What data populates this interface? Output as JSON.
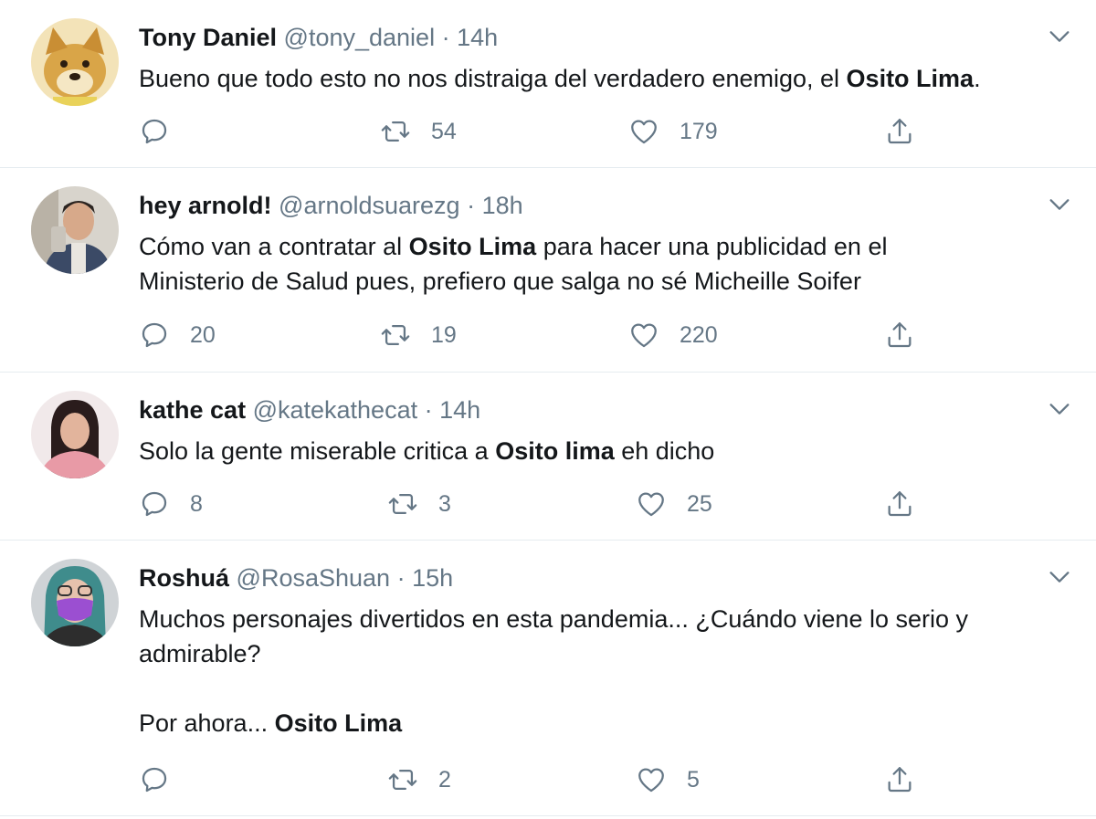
{
  "tweets": [
    {
      "name": "Tony Daniel",
      "handle": "@tony_daniel",
      "separator": "·",
      "time": "14h",
      "text_parts": [
        "Bueno que todo esto no nos distraiga del verdadero enemigo, el ",
        "Osito Lima",
        "."
      ],
      "replies": "",
      "retweets": "54",
      "likes": "179",
      "avatar": "shiba-dog-avatar"
    },
    {
      "name": "hey arnold!",
      "handle": "@arnoldsuarezg",
      "separator": "·",
      "time": "18h",
      "text_parts": [
        "Cómo van a contratar al ",
        "Osito Lima",
        " para hacer una publicidad en el Ministerio de Salud pues, prefiero que salga no sé Micheille Soifer"
      ],
      "replies": "20",
      "retweets": "19",
      "likes": "220",
      "avatar": "young-man-avatar"
    },
    {
      "name": "kathe cat",
      "handle": "@katekathecat",
      "separator": "·",
      "time": "14h",
      "text_parts": [
        "Solo la gente miserable critica a ",
        "Osito lima",
        " eh dicho"
      ],
      "replies": "8",
      "retweets": "3",
      "likes": "25",
      "avatar": "young-woman-avatar"
    },
    {
      "name": "Roshuá",
      "handle": "@RosaShuan",
      "separator": "·",
      "time": "15h",
      "text_parts": [
        "Muchos personajes divertidos en esta pandemia... ¿Cuándo viene lo serio y admirable?\n\nPor ahora... ",
        "Osito Lima",
        ""
      ],
      "replies": "",
      "retweets": "2",
      "likes": "5",
      "avatar": "masked-woman-avatar"
    }
  ],
  "icons": {
    "reply": "reply-icon",
    "retweet": "retweet-icon",
    "like": "heart-icon",
    "share": "share-icon",
    "menu": "chevron-down-icon"
  },
  "colors": {
    "text": "#14171a",
    "secondary": "#657786",
    "divider": "#e6ecf0"
  }
}
